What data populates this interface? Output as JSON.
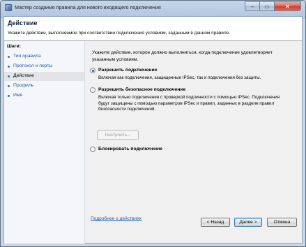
{
  "window": {
    "title": "Мастер создания правила для нового входящего подключения",
    "min_glyph": "–",
    "max_glyph": "▭",
    "close_glyph": "✕"
  },
  "header": {
    "title": "Действие",
    "subtitle": "Укажите действие, выполняемое при соответствии подключения условиям, заданным в данном правиле."
  },
  "steps": {
    "title": "Шаги:",
    "items": [
      {
        "label": "Тип правила",
        "active": false
      },
      {
        "label": "Протокол и порты",
        "active": false
      },
      {
        "label": "Действие",
        "active": true
      },
      {
        "label": "Профиль",
        "active": false
      },
      {
        "label": "Имя",
        "active": false
      }
    ]
  },
  "main": {
    "prompt": "Укажите действие, которое должно выполняться, когда подключение удовлетворяет указанным условиям.",
    "options": [
      {
        "label": "Разрешить подключение",
        "selected": true,
        "desc": "Включая как подключения, защищенные IPSec, так и подключения без защиты."
      },
      {
        "label": "Разрешить безопасное подключение",
        "selected": false,
        "desc": "Включая только подключения с проверкой подлинности с помощью IPSec. Подключения будут защищены с помощью параметров IPSec и правил, заданных в разделе правил безопасности подключений."
      },
      {
        "label": "Блокировать подключение",
        "selected": false,
        "desc": ""
      }
    ],
    "customize_label": "Настроить...",
    "help_link": "Подробнее о действиях"
  },
  "buttons": {
    "back": "< Назад",
    "next": "Далее >",
    "cancel": "Отмена"
  }
}
